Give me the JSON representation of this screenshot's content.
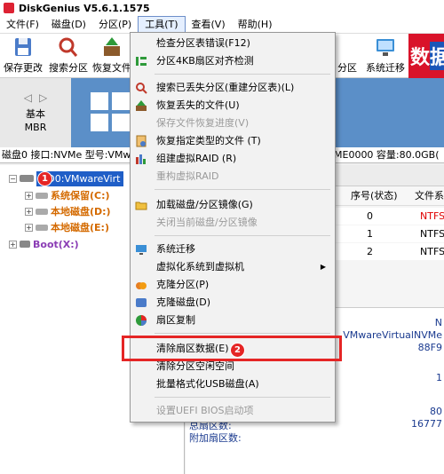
{
  "app": {
    "title": "DiskGenius V5.6.1.1575"
  },
  "menubar": {
    "items": [
      {
        "label": "文件(F)"
      },
      {
        "label": "磁盘(D)"
      },
      {
        "label": "分区(P)"
      },
      {
        "label": "工具(T)"
      },
      {
        "label": "查看(V)"
      },
      {
        "label": "帮助(H)"
      }
    ]
  },
  "toolbar": {
    "save_label": "保存更改",
    "search_label": "搜索分区",
    "recover_label": "恢复文件",
    "partition_label": "分区",
    "migrate_label": "系统迁移",
    "ad_text": "数",
    "ad_text2": "据"
  },
  "disk_nav": {
    "line1": "基本",
    "line2": "MBR"
  },
  "disk_info": {
    "left": "磁盘0 接口:NVMe  型号:VMw",
    "right": "ME0000  容量:80.0GB("
  },
  "tree": {
    "disk0": "HD0:VMwareVirt",
    "partitions": [
      {
        "label": "系统保留(C:)"
      },
      {
        "label": "本地磁盘(D:)"
      },
      {
        "label": "本地磁盘(E:)"
      }
    ],
    "boot": "Boot(X:)",
    "badge1": "1"
  },
  "table": {
    "headers": {
      "seq": "序号(状态)",
      "fs": "文件系"
    },
    "rows": [
      {
        "seq": "0",
        "fs": "NTFS"
      },
      {
        "seq": "1",
        "fs": "NTFS"
      },
      {
        "seq": "2",
        "fs": "NTFS"
      }
    ]
  },
  "info": {
    "r1": "N",
    "r2": "VMwareVirtualNVMe",
    "r3": "88F9",
    "r4": "1",
    "r5": "80",
    "r6": "16777",
    "l1": "总扇区数:",
    "l2": "附加扇区数:"
  },
  "tools_menu": {
    "items": [
      {
        "label": "检查分区表错误(F12)",
        "enabled": true
      },
      {
        "label": "分区4KB扇区对齐检测",
        "enabled": true
      },
      {
        "label": "搜索已丢失分区(重建分区表)(L)",
        "enabled": true
      },
      {
        "label": "恢复丢失的文件(U)",
        "enabled": true
      },
      {
        "label": "保存文件恢复进度(V)",
        "enabled": false
      },
      {
        "label": "恢复指定类型的文件 (T)",
        "enabled": true
      },
      {
        "label": "组建虚拟RAID (R)",
        "enabled": true
      },
      {
        "label": "重构虚拟RAID",
        "enabled": false
      },
      {
        "label": "加载磁盘/分区镜像(G)",
        "enabled": true
      },
      {
        "label": "关闭当前磁盘/分区镜像",
        "enabled": false
      },
      {
        "label": "系统迁移",
        "enabled": true
      },
      {
        "label": "虚拟化系统到虚拟机",
        "enabled": true
      },
      {
        "label": "克隆分区(P)",
        "enabled": true
      },
      {
        "label": "克隆磁盘(D)",
        "enabled": true
      },
      {
        "label": "扇区复制",
        "enabled": true
      },
      {
        "label": "清除扇区数据(E)",
        "enabled": true
      },
      {
        "label": "清除分区空闲空间",
        "enabled": true
      },
      {
        "label": "批量格式化USB磁盘(A)",
        "enabled": true
      },
      {
        "label": "设置UEFI BIOS启动项",
        "enabled": false
      }
    ],
    "badge2": "2"
  },
  "colors": {
    "accent": "#1f5ec7",
    "highlight": "#e52525",
    "diskbar": "#5b8fc8"
  }
}
